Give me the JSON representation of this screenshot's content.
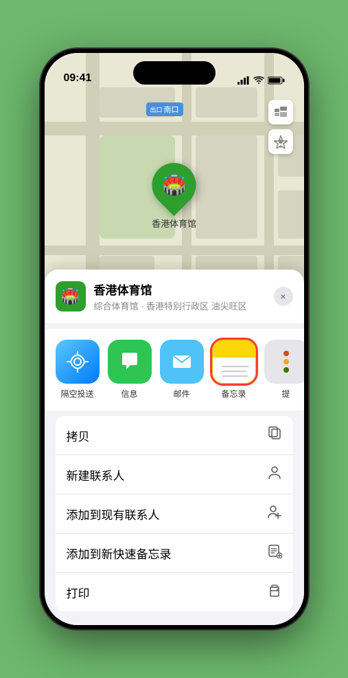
{
  "statusBar": {
    "time": "09:41",
    "locationIcon": "▶"
  },
  "map": {
    "label": "南口",
    "labelPrefix": "出口"
  },
  "pin": {
    "label": "香港体育馆",
    "emoji": "🏟️"
  },
  "venueHeader": {
    "name": "香港体育馆",
    "subtitle": "综合体育馆 · 香港特别行政区 油尖旺区",
    "closeLabel": "×"
  },
  "shareItems": [
    {
      "id": "airdrop",
      "label": "隔空投送",
      "type": "airdrop"
    },
    {
      "id": "messages",
      "label": "信息",
      "type": "messages"
    },
    {
      "id": "mail",
      "label": "邮件",
      "type": "mail"
    },
    {
      "id": "notes",
      "label": "备忘录",
      "type": "notes",
      "selected": true
    },
    {
      "id": "more",
      "label": "提",
      "type": "more"
    }
  ],
  "actionItems": [
    {
      "id": "copy",
      "label": "拷贝",
      "icon": "copy"
    },
    {
      "id": "new-contact",
      "label": "新建联系人",
      "icon": "person"
    },
    {
      "id": "add-existing",
      "label": "添加到现有联系人",
      "icon": "person-plus"
    },
    {
      "id": "add-notes",
      "label": "添加到新快速备忘录",
      "icon": "note"
    },
    {
      "id": "print",
      "label": "打印",
      "icon": "printer"
    }
  ]
}
